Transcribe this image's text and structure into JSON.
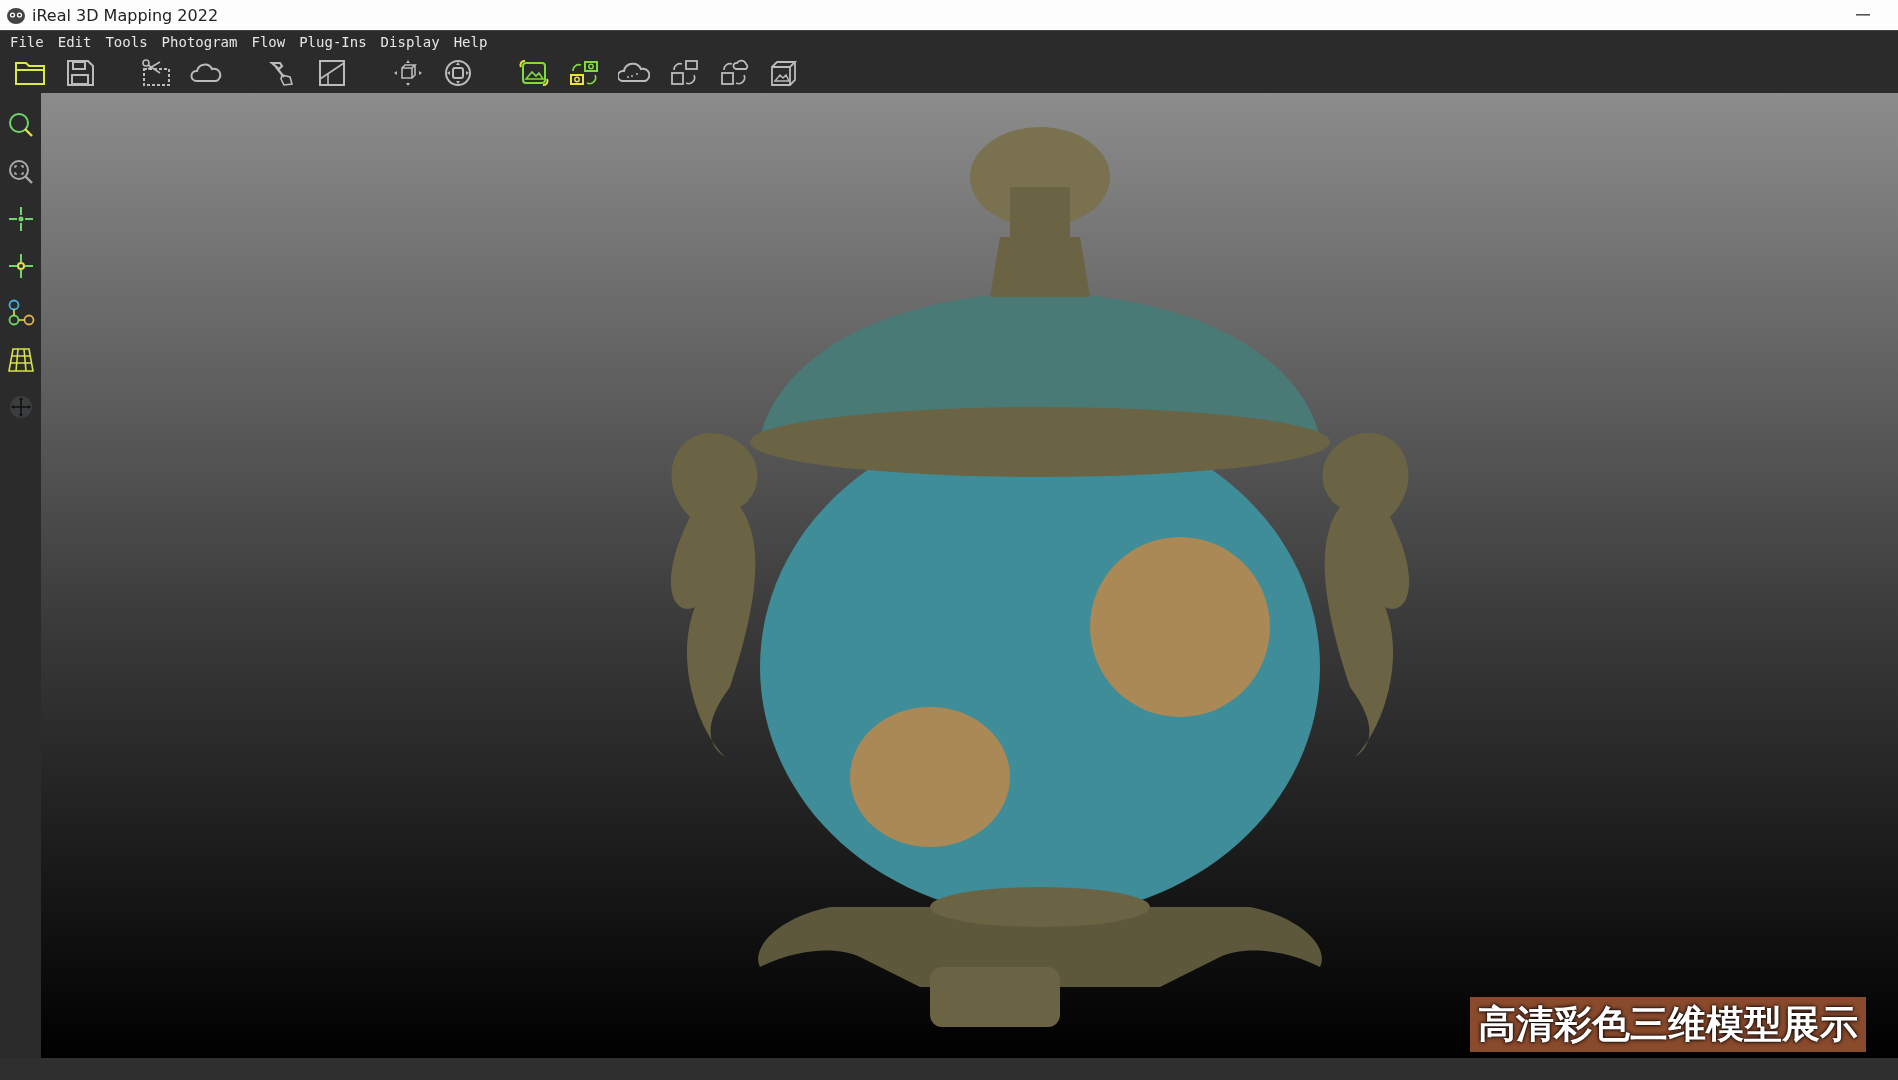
{
  "window": {
    "title": "iReal 3D Mapping 2022"
  },
  "menu": [
    "File",
    "Edit",
    "Tools",
    "Photogram",
    "Flow",
    "Plug-Ins",
    "Display",
    "Help"
  ],
  "viewport": {
    "caption": "高清彩色三维模型展示"
  }
}
